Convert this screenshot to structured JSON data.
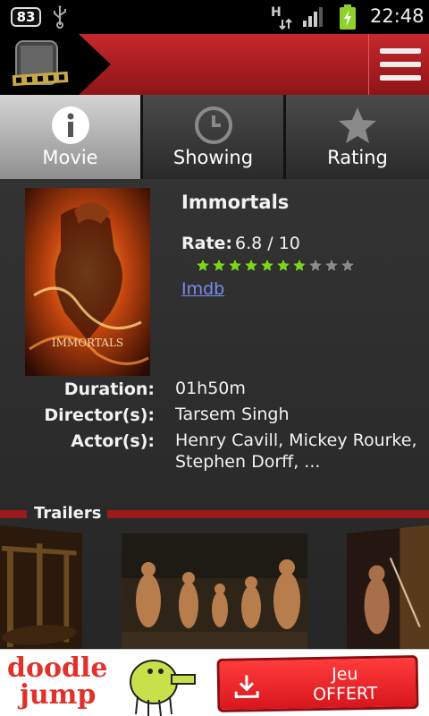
{
  "status_bar": {
    "notification_count": "83",
    "time": "22:48"
  },
  "tabs": [
    {
      "label": "Movie",
      "icon": "info-icon",
      "active": true
    },
    {
      "label": "Showing",
      "icon": "clock-icon",
      "active": false
    },
    {
      "label": "Rating",
      "icon": "star-icon",
      "active": false
    }
  ],
  "movie": {
    "title": "Immortals",
    "rate_label": "Rate:",
    "rate_value": "6.8 / 10",
    "rating_out_of_10": 6.8,
    "imdb_link": "Imdb",
    "duration_label": "Duration:",
    "duration": "01h50m",
    "director_label": "Director(s):",
    "director": "Tarsem Singh",
    "actors_label": "Actor(s):",
    "actors": "Henry Cavill, Mickey Rourke, Stephen Dorff, ..."
  },
  "trailers": {
    "title": "Trailers"
  },
  "ad": {
    "brand_line1": "doodle",
    "brand_line2": "jump",
    "cta_line1": "Jeu",
    "cta_line2": "OFFERT"
  },
  "colors": {
    "brand_red": "#c6282c",
    "link_blue": "#7b8cf0",
    "star_green": "#7ed321"
  }
}
